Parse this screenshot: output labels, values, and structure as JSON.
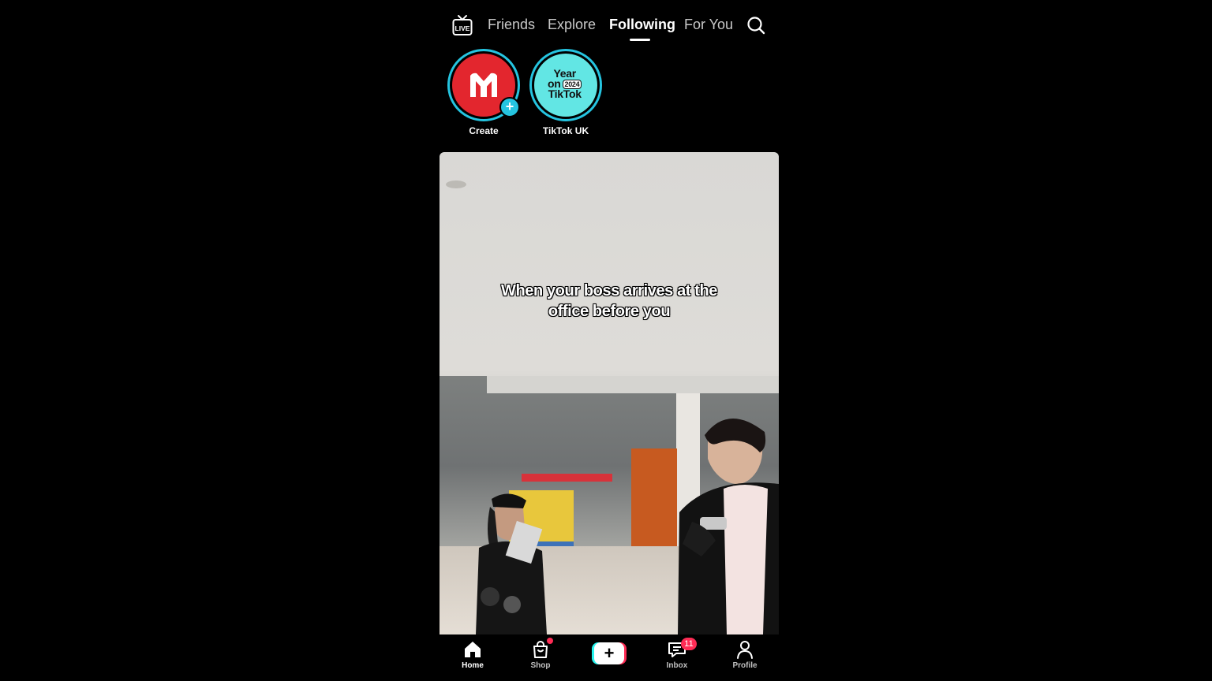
{
  "topnav": {
    "live_label": "LIVE",
    "tabs": [
      {
        "label": "Friends",
        "active": false
      },
      {
        "label": "Explore",
        "active": false
      },
      {
        "label": "Following",
        "active": true
      },
      {
        "label": "For You",
        "active": false
      }
    ]
  },
  "stories": [
    {
      "label": "Create",
      "logo_text": "M"
    },
    {
      "label": "TikTok UK",
      "logo_lines": [
        "Year",
        "on",
        "TikTok"
      ],
      "logo_badge": "2024"
    }
  ],
  "video": {
    "caption_line1": "When your boss arrives at the",
    "caption_line2": "office before you"
  },
  "bottomnav": {
    "items": [
      {
        "label": "Home",
        "icon": "home-icon",
        "active": true
      },
      {
        "label": "Shop",
        "icon": "shopping-bag-icon",
        "active": false
      },
      {
        "label": "Inbox",
        "icon": "inbox-icon",
        "active": false,
        "badge": "11"
      },
      {
        "label": "Profile",
        "icon": "person-icon",
        "active": false
      }
    ]
  },
  "colors": {
    "background": "#000000",
    "accent_cyan": "#25f4ee",
    "accent_pink": "#fe2c55",
    "story_ring": "#25c4e0"
  }
}
